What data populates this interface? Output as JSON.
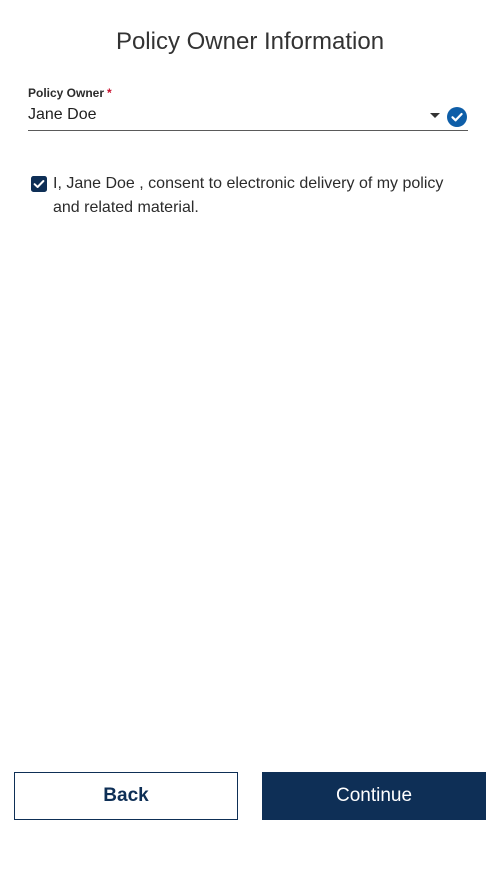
{
  "page": {
    "title": "Policy Owner Information"
  },
  "policy_owner_field": {
    "label": "Policy Owner",
    "required_marker": "*",
    "value": "Jane Doe",
    "dropdown_icon": "caret-down-icon",
    "status_icon": "check-circle-icon",
    "status_color": "#0e5ea8"
  },
  "consent": {
    "checked": true,
    "text": "I, Jane Doe , consent to electronic delivery of my policy and related material.",
    "checkbox_color": "#0e2f56"
  },
  "actions": {
    "back_label": "Back",
    "continue_label": "Continue",
    "primary_color": "#0e2f56"
  }
}
